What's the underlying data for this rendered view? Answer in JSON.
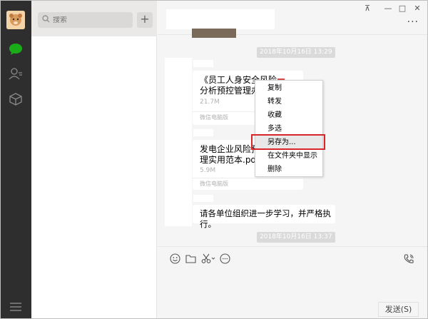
{
  "search": {
    "placeholder": "搜索"
  },
  "window_controls": {
    "pin": "⊼",
    "minimize": "—",
    "maximize": "□",
    "close": "✕"
  },
  "header": {
    "more": "···"
  },
  "messages": {
    "timestamp_1": "2018年10月16日 13:29",
    "timestamp_2": "2018年10月16日 13:37",
    "file_1": {
      "title_line1": "《员工人身安全风险",
      "title_line2": "分析预控管理办法",
      "size": "21.7M",
      "source": "微信电脑版"
    },
    "file_2": {
      "title_line1": "发电企业风险预控",
      "title_line2": "理实用范本.pdf",
      "size": "5.9M",
      "source": "微信电脑版"
    },
    "text_1": "请各单位组织进一步学习，并严格执行。"
  },
  "context_menu": {
    "items": [
      "复制",
      "转发",
      "收藏",
      "多选",
      "另存为...",
      "在文件夹中显示",
      "删除"
    ],
    "highlighted_index": 4
  },
  "input": {
    "send_label": "发送(S)"
  },
  "colors": {
    "rail": "#2e2e2e",
    "accent_green": "#1aad19",
    "highlight_red": "#d9262b"
  }
}
